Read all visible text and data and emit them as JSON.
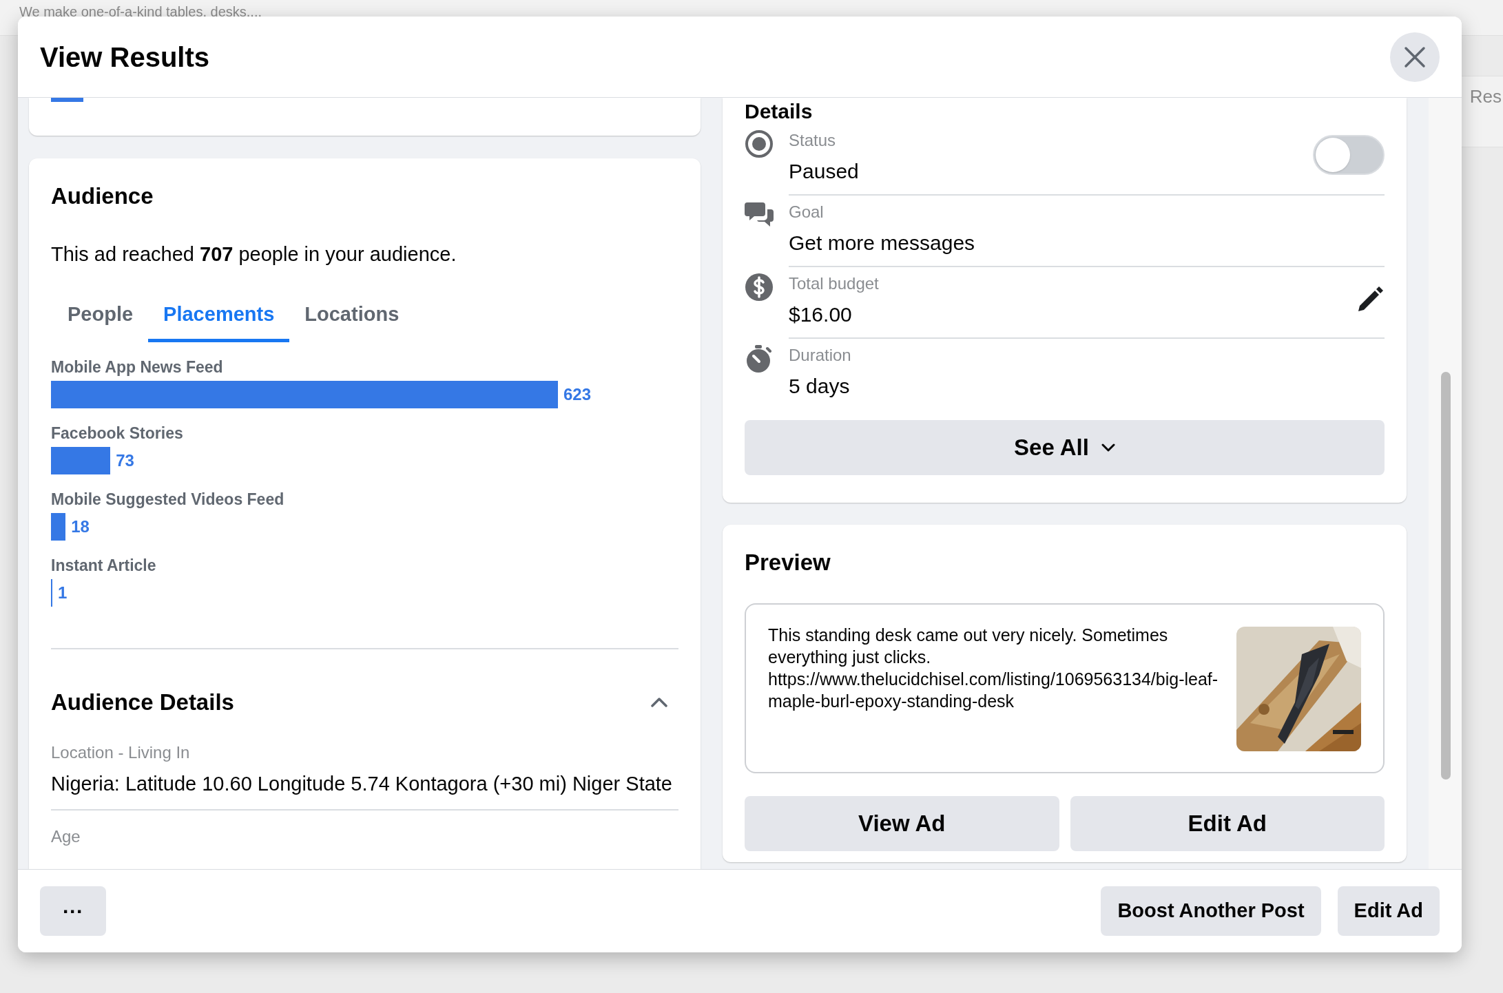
{
  "background_page": {
    "tagline": "We make one-of-a-kind tables, desks,...",
    "side_text": "Res"
  },
  "dialog": {
    "title": "View Results"
  },
  "audience": {
    "heading": "Audience",
    "summary": "This ad reached **707** people in your audience.",
    "tabs": [
      {
        "label": "People",
        "selected": false
      },
      {
        "label": "Placements",
        "selected": true
      },
      {
        "label": "Locations",
        "selected": false
      }
    ],
    "chart_data": {
      "type": "bar",
      "orientation": "horizontal",
      "data_labels": true,
      "categories": [
        "Mobile App News Feed",
        "Facebook Stories",
        "Mobile Suggested Videos Feed",
        "Instant Article"
      ],
      "series": [
        {
          "color": "#3578e5",
          "values": [
            623,
            73,
            18,
            1
          ]
        }
      ]
    },
    "details_heading": "Audience Details",
    "details_expanded": true,
    "details": [
      {
        "label": "Location - Living In",
        "value": "Nigeria: Latitude 10.60 Longitude 5.74 Kontagora (+30 mi) Niger State"
      },
      {
        "label": "Age"
      }
    ]
  },
  "details": {
    "heading": "Details",
    "rows": [
      {
        "kind": "status",
        "label": "Status",
        "value": "Paused",
        "on": false
      },
      {
        "kind": "goal",
        "label": "Goal",
        "value": "Get more messages"
      },
      {
        "kind": "budget",
        "label": "Total budget",
        "value": "$16.00",
        "editable": true
      },
      {
        "kind": "duration",
        "label": "Duration",
        "value": "5 days"
      }
    ],
    "see_all": "See All"
  },
  "preview": {
    "heading": "Preview",
    "text": "This standing desk came out very nicely. Sometimes everything just clicks. https://www.thelucidchisel.com/listing/1069563134/big-leaf-maple-burl-epoxy-standing-desk",
    "image": {
      "kind": "picture"
    },
    "buttons": [
      "View Ad",
      "Edit Ad"
    ]
  },
  "footer": {
    "more": "···",
    "buttons": [
      "Boost Another Post",
      "Edit Ad"
    ]
  }
}
